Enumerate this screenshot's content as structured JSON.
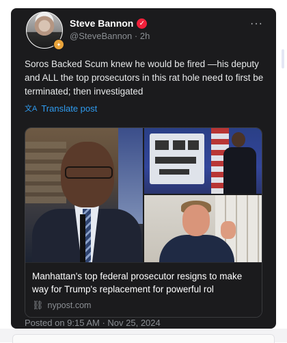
{
  "post": {
    "author_name": "Steve Bannon",
    "handle": "@SteveBannon",
    "separator": "·",
    "age": "2h",
    "more_label": "···",
    "verified_glyph": "✓",
    "avatar_badge_glyph": "✦",
    "text": "Soros Backed Scum knew he would be fired —his deputy and ALL the top prosecutors in this rat hole need to first be terminated; then investigated",
    "translate_icon": "文A",
    "translate_label": "Translate post",
    "link_card": {
      "headline": "Manhattan's top federal prosecutor resigns to make way for Trump's replacement for powerful rol",
      "link_icon": "⛓",
      "source": "nypost.com"
    },
    "posted_at": "Posted on 9:15 AM · Nov 25, 2024"
  },
  "colors": {
    "card_background": "#1b1b1d",
    "verified_badge": "#f0203a",
    "translate_link": "#2f9cf0",
    "muted_text": "#8b8f94"
  },
  "icons": [
    "verified-badge-icon",
    "more-options-icon",
    "translate-icon",
    "link-icon"
  ]
}
